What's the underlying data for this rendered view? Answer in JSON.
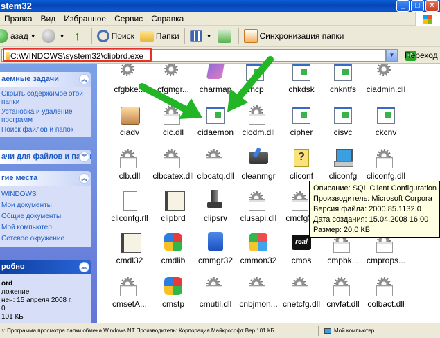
{
  "window": {
    "title": "stem32"
  },
  "menu": [
    "Правка",
    "Вид",
    "Избранное",
    "Сервис",
    "Справка"
  ],
  "toolbar": {
    "back": "азад",
    "search": "Поиск",
    "folders": "Папки",
    "sync": "Синхронизация папки"
  },
  "address": {
    "value": "C:\\WINDOWS\\system32\\clipbrd.exe",
    "go": "Переход"
  },
  "taskpane": {
    "file_tasks": {
      "title": "аемные задачи",
      "links": [
        "Скрыть содержимое этой",
        "папки",
        "Установка и удаление",
        "программ",
        "Поиск файлов и папок"
      ]
    },
    "file_folder_tasks": {
      "title": "ачи для файлов и папок"
    },
    "other_places": {
      "title": "гие места",
      "links": [
        "WINDOWS",
        "Мои документы",
        "Общие документы",
        "Мой компьютер",
        "Сетевое окружение"
      ]
    },
    "details": {
      "title": "робно",
      "name": "ord",
      "type": "ложение",
      "modified": "нен: 15 апреля 2008 г.,",
      "extra": "0",
      "size": "101 КБ"
    }
  },
  "files": [
    "cfgbke...",
    "cfgmgr...",
    "charmap",
    "chcp",
    "chkdsk",
    "chkntfs",
    "ciadmin.dll",
    "ciadv",
    "cic.dll",
    "cidaemon",
    "ciodm.dll",
    "cipher",
    "cisvc",
    "ckcnv",
    "clb.dll",
    "clbcatex.dll",
    "clbcatq.dll",
    "cleanmgr",
    "cliconf",
    "cliconfg",
    "cliconfg.dll",
    "cliconfg.rll",
    "clipbrd",
    "clipsrv",
    "clusapi.dll",
    "cmcfg32",
    "",
    "",
    "cmdl32",
    "cmdlib",
    "cmmgr32",
    "cmmon32",
    "cmos",
    "cmpbk...",
    "cmprops...",
    "cmsetA...",
    "cmstp",
    "cmutil.dll",
    "cnbjmon...",
    "cnetcfg.dll",
    "cnvfat.dll",
    "colbact.dll"
  ],
  "tooltip": [
    "Описание: SQL Client Configuration",
    "Производитель: Microsoft Corpora",
    "Версия файла: 2000.85.1132.0",
    "Дата создания: 15.04.2008 16:00",
    "Размер: 20,0 КБ"
  ],
  "status": {
    "main": "з: Программа просмотра папки обмена Windows NT Производитель: Корпорация Майкрософт Вер 101 КБ",
    "computer": "Мой компьютер"
  },
  "colors": {
    "arrow": "#22b526",
    "highlight": "#e8302a",
    "tooltip": "#ffffe1"
  }
}
